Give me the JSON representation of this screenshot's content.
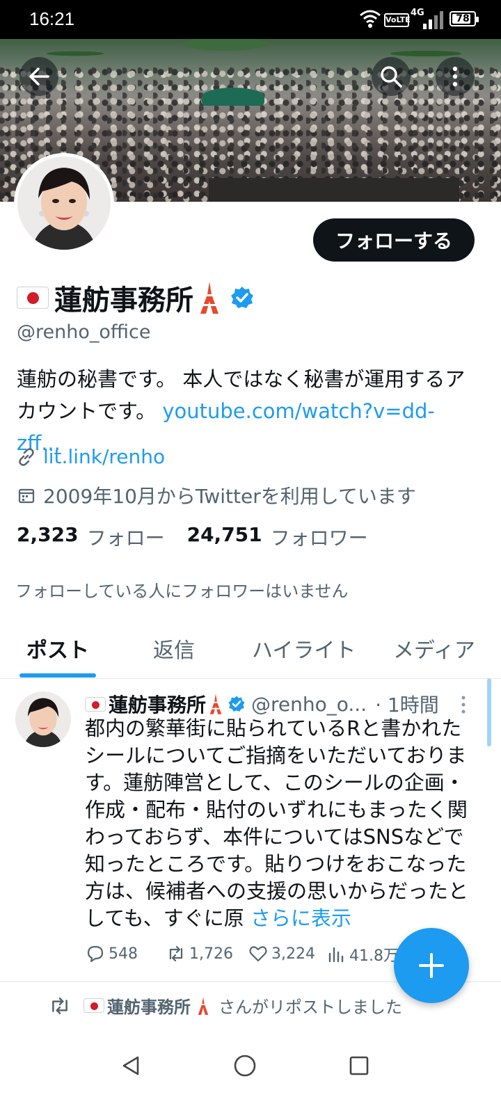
{
  "status_bar": {
    "time": "16:21",
    "volte": "VoLTE",
    "network": "4G",
    "battery": "78"
  },
  "profile": {
    "follow_label": "フォローする",
    "display_name": "蓮舫事務所",
    "handle": "@renho_office",
    "bio_text": "蓮舫の秘書です。 本人ではなく秘書が運用するアカウントです。",
    "bio_link": "youtube.com/watch?v=dd-zff...",
    "website": "lit.link/renho",
    "joined": "2009年10月からTwitterを利用しています",
    "following_count": "2,323",
    "following_label": "フォロー",
    "followers_count": "24,751",
    "followers_label": "フォロワー",
    "no_followers_note": "フォローしている人にフォロワーはいません"
  },
  "tabs": [
    "ポスト",
    "返信",
    "ハイライト",
    "メディア"
  ],
  "tweet": {
    "name": "蓮舫事務所",
    "handle": "@renho_o...",
    "time": "· 1時間",
    "text": "都内の繁華街に貼られているRと書かれたシールについてご指摘をいただいております。蓮舫陣営として、このシールの企画・作成・配布・貼付のいずれにもまったく関わっておらず、本件についてはSNSなどで知ったところです。貼りつけをおこなった方は、候補者への支援の思いからだったとしても、すぐに原",
    "show_more": "さらに表示",
    "replies": "548",
    "reposts": "1,726",
    "likes": "3,224",
    "views": "41.8万"
  },
  "repost_notice": {
    "name": "蓮舫事務所",
    "suffix": "さんがリポストしました"
  },
  "colors": {
    "accent": "#1d9bf0",
    "text": "#0f1419",
    "secondary": "#536471"
  },
  "icons": [
    "back-arrow-icon",
    "search-icon",
    "more-vertical-icon",
    "verified-badge-icon",
    "tokyo-tower-icon",
    "link-icon",
    "calendar-icon",
    "reply-icon",
    "repost-icon",
    "like-icon",
    "views-icon",
    "plus-icon"
  ]
}
